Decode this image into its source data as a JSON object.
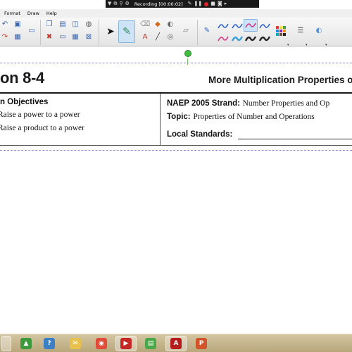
{
  "recording_bar": {
    "status": "Recording [00:00:02]"
  },
  "menu": {
    "items": [
      "Format",
      "Draw",
      "Help"
    ]
  },
  "toolbar": {
    "pen_colors": [
      "#2f63c9",
      "#d23a8a",
      "#2f63c9",
      "#3aa0d8",
      "#d23a8a",
      "#222222"
    ]
  },
  "slide": {
    "title": "on 8-4",
    "subtitle": "More Multiplication Properties o",
    "objectives_heading": "n Objectives",
    "objectives": [
      "Raise a power to a power",
      "Raise a product to a power"
    ],
    "naep_label": "NAEP 2005 Strand:",
    "naep_value": "Number Properties and Op",
    "topic_label": "Topic:",
    "topic_value": "Properties of Number and Operations",
    "local_standards_label": "Local Standards:"
  },
  "taskbar": {
    "apps": [
      {
        "name": "app-green-icon",
        "color": "#3c9a3c",
        "glyph": "▲"
      },
      {
        "name": "app-notebook-icon",
        "color": "#3d7fc4",
        "glyph": "?"
      },
      {
        "name": "app-mail-icon",
        "color": "#e8c04a",
        "glyph": "✉"
      },
      {
        "name": "chrome-icon",
        "color": "#e04b3a",
        "glyph": "◉"
      },
      {
        "name": "media-player-icon",
        "color": "#c62828",
        "glyph": "▶"
      },
      {
        "name": "calculator-icon",
        "color": "#4aa84a",
        "glyph": "▤"
      },
      {
        "name": "acrobat-icon",
        "color": "#b71c1c",
        "glyph": "A"
      },
      {
        "name": "powerpoint-icon",
        "color": "#d2542a",
        "glyph": "P"
      }
    ]
  }
}
